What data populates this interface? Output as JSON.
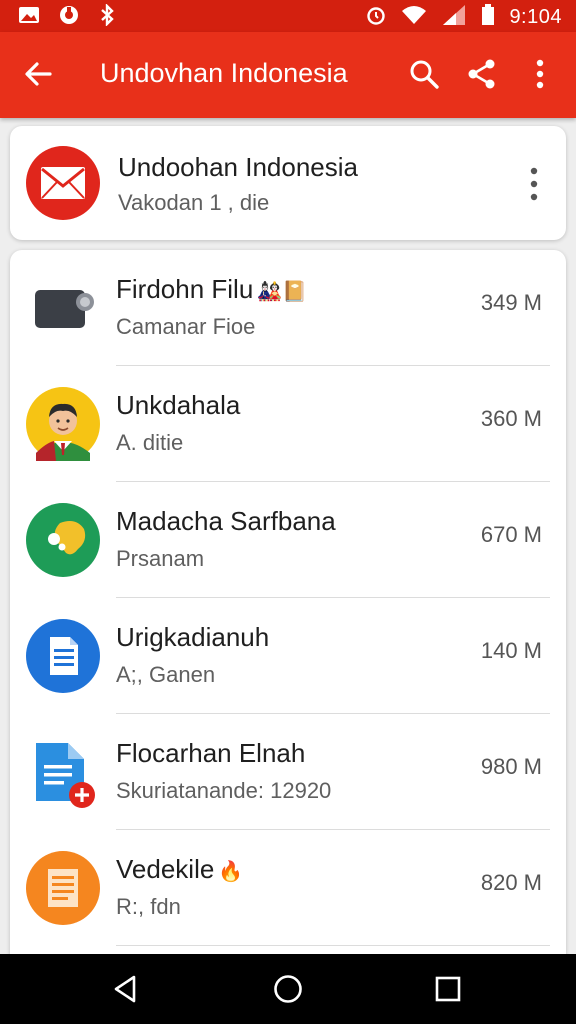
{
  "status_bar": {
    "time": "9:104",
    "icons_left": [
      "gallery-icon",
      "vpn-icon",
      "bluetooth-icon"
    ],
    "icons_right": [
      "alarm-icon",
      "wifi-icon",
      "signal-icon",
      "battery-icon"
    ]
  },
  "app_bar": {
    "title": "Undovhan Indonesia",
    "background": "#e8301a",
    "status_background": "#d3200f",
    "actions": [
      "search-icon",
      "share-icon",
      "more-vert-icon"
    ]
  },
  "header_card": {
    "title": "Undoohan Indonesia",
    "subtitle": "Vakodan 1 , die",
    "icon": "mail-icon",
    "icon_color": "#e0261c"
  },
  "list": {
    "items": [
      {
        "title": "Firdohn Filu",
        "title_emoji": "🎎📔",
        "subtitle": "Camanar Fioe",
        "size": "349 M",
        "icon": "camera-icon"
      },
      {
        "title": "Unkdahala",
        "title_emoji": "",
        "subtitle": "A. ditie",
        "size": "360 M",
        "icon": "person-avatar-icon"
      },
      {
        "title": "Madacha Sarfbana",
        "title_emoji": "",
        "subtitle": "Prsanam",
        "size": "670 M",
        "icon": "map-icon"
      },
      {
        "title": "Urigkadianuh",
        "title_emoji": "",
        "subtitle": "A;, Ganen",
        "size": "140 M",
        "icon": "document-icon"
      },
      {
        "title": "Flocarhan Elnah",
        "title_emoji": "",
        "subtitle": "Skuriatanande: 12920",
        "size": "980 M",
        "icon": "file-add-icon"
      },
      {
        "title": "Vedekile",
        "title_emoji": "🔥",
        "subtitle": "R:, fdn",
        "size": "820 M",
        "icon": "notes-icon"
      }
    ]
  },
  "nav_bar": {
    "buttons": [
      "back-icon",
      "home-icon",
      "recents-icon"
    ]
  }
}
